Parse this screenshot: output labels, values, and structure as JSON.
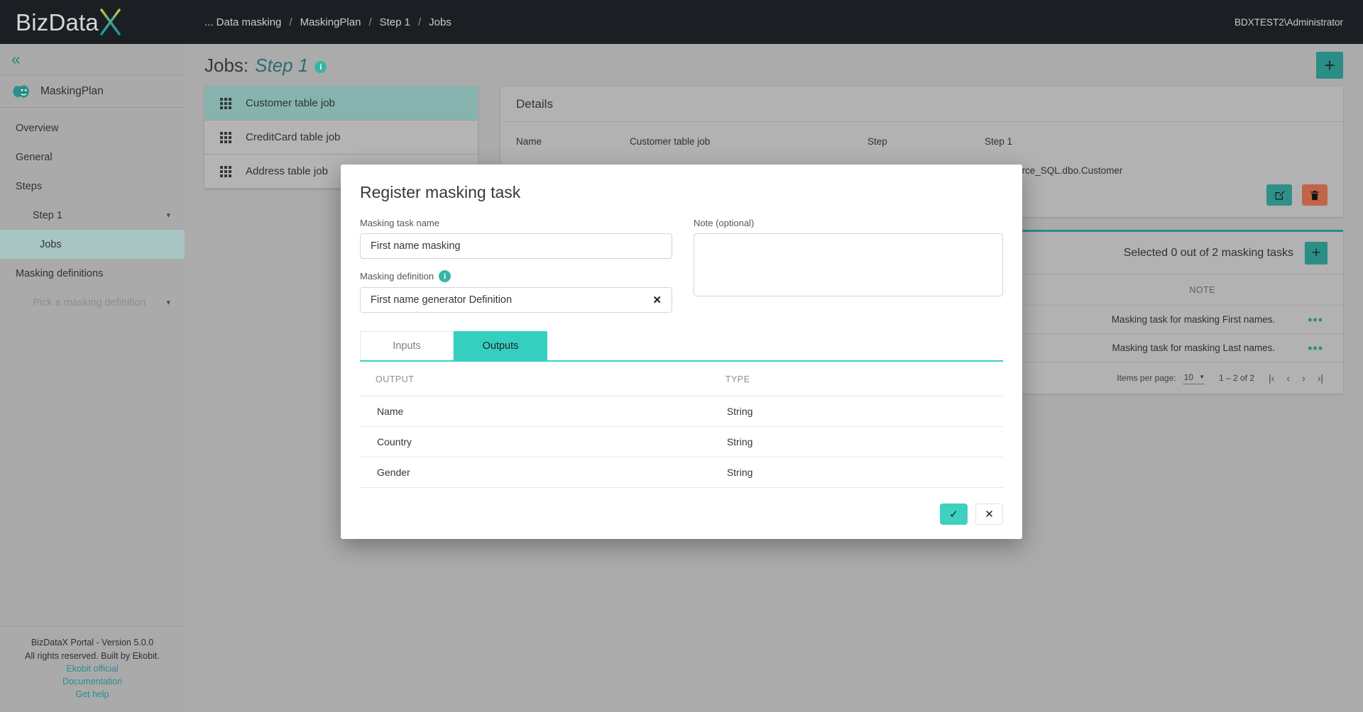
{
  "brand": {
    "name_text": "BizData",
    "x_letter": "X",
    "accent": "#35b5a8",
    "dark": "#1b1f24"
  },
  "topbar": {
    "breadcrumbs": [
      "... Data masking",
      "MaskingPlan",
      "Step 1",
      "Jobs"
    ],
    "separator": "/",
    "user": "BDXTEST2\\Administrator"
  },
  "sidebar": {
    "collapse_icon": "«",
    "plan_name": "MaskingPlan",
    "items": [
      {
        "label": "Overview",
        "level": 0,
        "active": false,
        "muted": false,
        "caret": ""
      },
      {
        "label": "General",
        "level": 0,
        "active": false,
        "muted": false,
        "caret": ""
      },
      {
        "label": "Steps",
        "level": 0,
        "active": false,
        "muted": false,
        "caret": ""
      },
      {
        "label": "Step 1",
        "level": 1,
        "active": false,
        "muted": false,
        "caret": "▾"
      },
      {
        "label": "Jobs",
        "level": 2,
        "active": true,
        "muted": false,
        "caret": ""
      },
      {
        "label": "Masking definitions",
        "level": 0,
        "active": false,
        "muted": false,
        "caret": ""
      },
      {
        "label": "Pick a masking definition",
        "level": 1,
        "active": false,
        "muted": true,
        "caret": "▾"
      }
    ],
    "footer": {
      "version": "BizDataX Portal - Version 5.0.0",
      "rights": "All rights reserved. Built by Ekobit.",
      "links": [
        "Ekobit official",
        "Documentation",
        "Get help"
      ]
    }
  },
  "page": {
    "title_prefix": "Jobs:",
    "title_emphasis": "Step 1",
    "info_glyph": "i",
    "add_label": "+"
  },
  "jobs": [
    {
      "name": "Customer table job",
      "selected": true
    },
    {
      "name": "CreditCard table job",
      "selected": false
    },
    {
      "name": "Address table job",
      "selected": false
    }
  ],
  "details": {
    "heading": "Details",
    "rows": [
      {
        "k1": "Name",
        "v1": "Customer table job",
        "k2": "Step",
        "v2": "Step 1"
      },
      {
        "k1": "",
        "v1": "",
        "k2": "",
        "v2": "DataSource_SQL.dbo.Customer"
      }
    ],
    "edit_icon": "✎",
    "delete_icon": "🗑"
  },
  "masking_tasks": {
    "summary": "Selected 0 out of 2 masking tasks",
    "add_label": "+",
    "column_note": "NOTE",
    "rows": [
      {
        "note": "Masking task for masking First names.",
        "menu": "•••"
      },
      {
        "note": "Masking task for masking Last names.",
        "menu": "•••"
      }
    ],
    "pager": {
      "items_per_page_label": "Items per page:",
      "items_per_page_value": "10",
      "range": "1 – 2 of 2",
      "first": "|‹",
      "prev": "‹",
      "next": "›",
      "last": "›|"
    }
  },
  "modal": {
    "title": "Register masking task",
    "name_label": "Masking task name",
    "name_value": "First name masking",
    "note_label": "Note (optional)",
    "note_value": "",
    "definition_label": "Masking definition",
    "definition_info_glyph": "i",
    "definition_value": "First name generator Definition",
    "definition_clear": "✕",
    "tabs": [
      {
        "label": "Inputs",
        "active": false
      },
      {
        "label": "Outputs",
        "active": true
      }
    ],
    "table": {
      "headers": [
        "OUTPUT",
        "TYPE"
      ],
      "rows": [
        {
          "output": "Name",
          "type": "String"
        },
        {
          "output": "Country",
          "type": "String"
        },
        {
          "output": "Gender",
          "type": "String"
        }
      ]
    },
    "confirm_icon": "✓",
    "cancel_icon": "✕"
  }
}
